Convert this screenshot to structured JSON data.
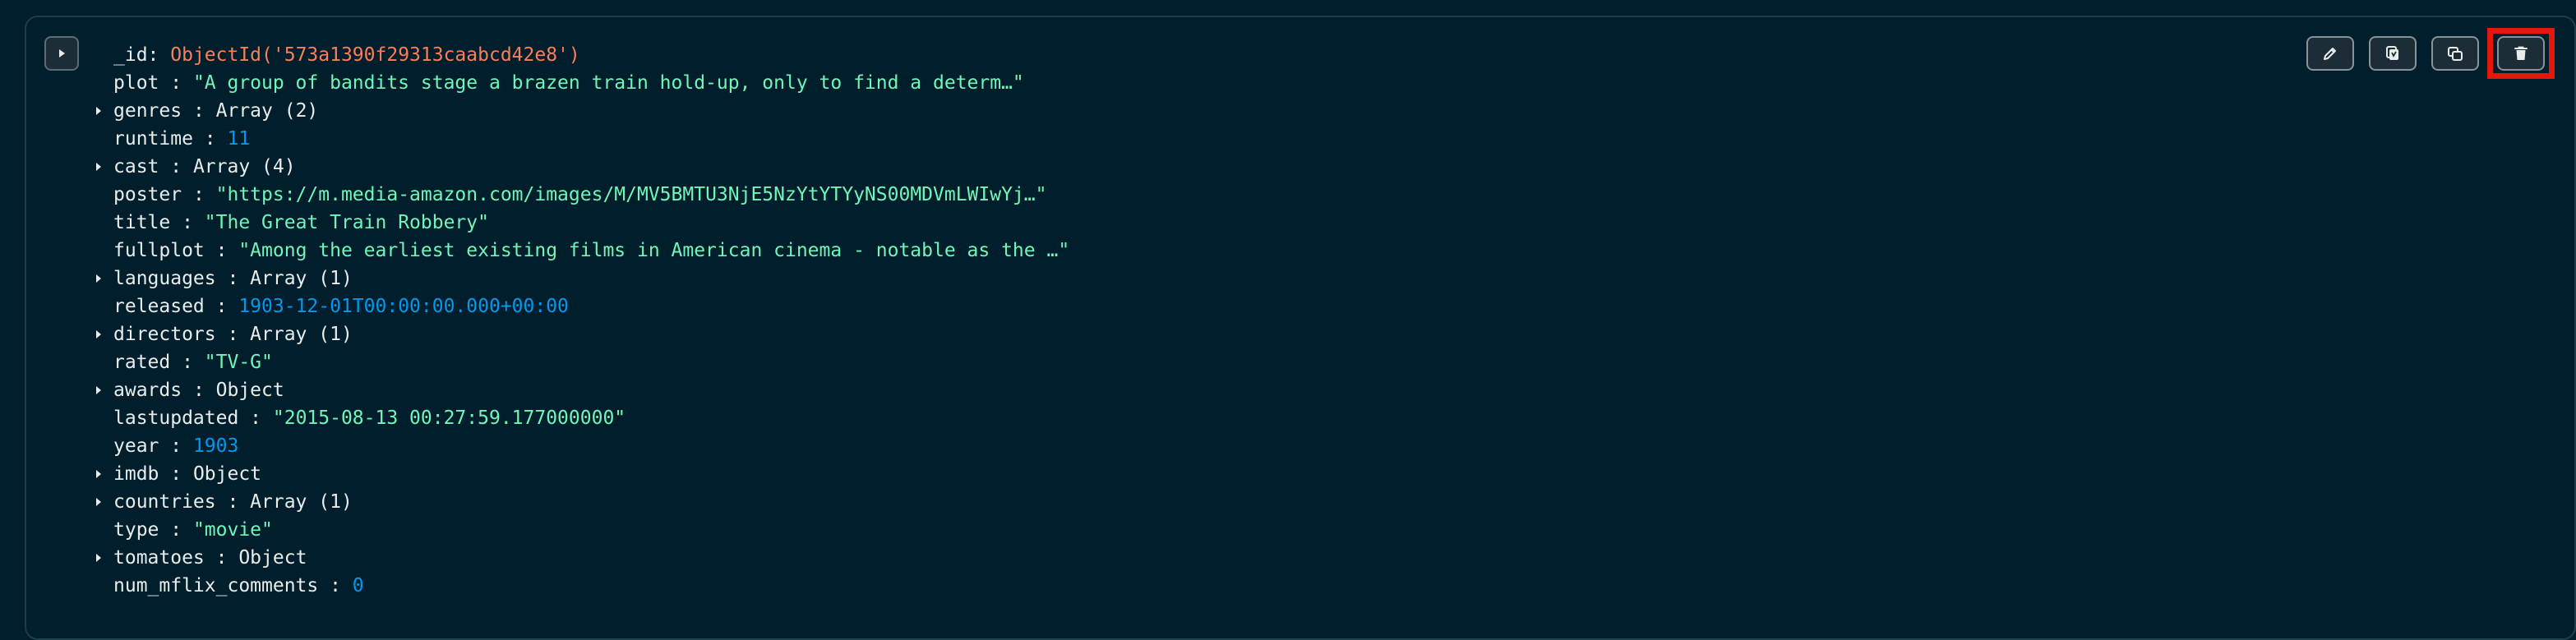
{
  "document": {
    "fields": [
      {
        "key": "_id",
        "value": "ObjectId('573a1390f29313caabcd42e8')",
        "kind": "objid",
        "expandable": false
      },
      {
        "key": "plot",
        "value": "\"A group of bandits stage a brazen train hold-up, only to find a determ…\"",
        "kind": "string",
        "expandable": false
      },
      {
        "key": "genres",
        "value": "Array (2)",
        "kind": "meta",
        "expandable": true
      },
      {
        "key": "runtime",
        "value": "11",
        "kind": "number",
        "expandable": false
      },
      {
        "key": "cast",
        "value": "Array (4)",
        "kind": "meta",
        "expandable": true
      },
      {
        "key": "poster",
        "value": "\"https://m.media-amazon.com/images/M/MV5BMTU3NjE5NzYtYTYyNS00MDVmLWIwYj…\"",
        "kind": "string",
        "expandable": false
      },
      {
        "key": "title",
        "value": "\"The Great Train Robbery\"",
        "kind": "string",
        "expandable": false
      },
      {
        "key": "fullplot",
        "value": "\"Among the earliest existing films in American cinema - notable as the …\"",
        "kind": "string",
        "expandable": false
      },
      {
        "key": "languages",
        "value": "Array (1)",
        "kind": "meta",
        "expandable": true
      },
      {
        "key": "released",
        "value": "1903-12-01T00:00:00.000+00:00",
        "kind": "number",
        "expandable": false
      },
      {
        "key": "directors",
        "value": "Array (1)",
        "kind": "meta",
        "expandable": true
      },
      {
        "key": "rated",
        "value": "\"TV-G\"",
        "kind": "string",
        "expandable": false
      },
      {
        "key": "awards",
        "value": "Object",
        "kind": "meta",
        "expandable": true
      },
      {
        "key": "lastupdated",
        "value": "\"2015-08-13 00:27:59.177000000\"",
        "kind": "string",
        "expandable": false
      },
      {
        "key": "year",
        "value": "1903",
        "kind": "number",
        "expandable": false
      },
      {
        "key": "imdb",
        "value": "Object",
        "kind": "meta",
        "expandable": true
      },
      {
        "key": "countries",
        "value": "Array (1)",
        "kind": "meta",
        "expandable": true
      },
      {
        "key": "type",
        "value": "\"movie\"",
        "kind": "string",
        "expandable": false
      },
      {
        "key": "tomatoes",
        "value": "Object",
        "kind": "meta",
        "expandable": true
      },
      {
        "key": "num_mflix_comments",
        "value": "0",
        "kind": "number",
        "expandable": false
      }
    ]
  },
  "toolbar": {
    "icons": [
      "pencil-icon",
      "copy-icon",
      "clone-icon",
      "trash-icon"
    ]
  },
  "colors": {
    "background": "#001e2b",
    "string": "#71f6ba",
    "number": "#0498ec",
    "objectid": "#f97f5b",
    "highlight": "#e3170a"
  }
}
